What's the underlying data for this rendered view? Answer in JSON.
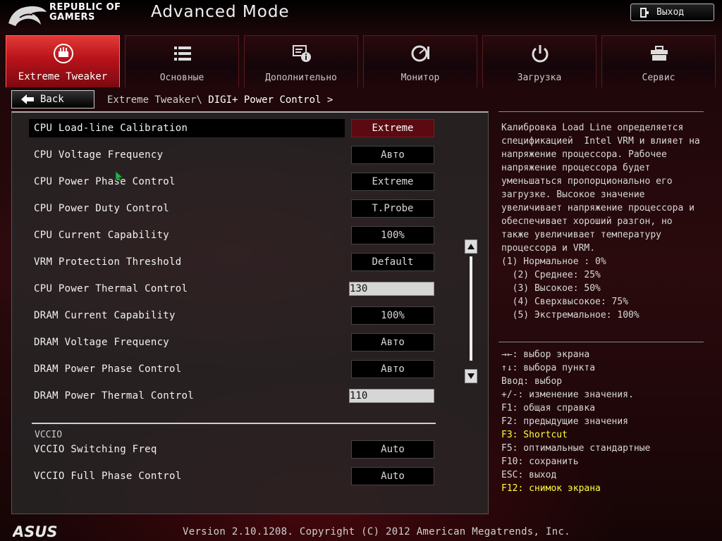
{
  "header": {
    "brand_line1": "REPUBLIC OF",
    "brand_line2": "GAMERS",
    "mode_title": "Advanced Mode",
    "exit_label": "Выход"
  },
  "tabs": [
    {
      "label": "Extreme Tweaker",
      "icon": "extreme-tweaker-icon",
      "active": true
    },
    {
      "label": "Основные",
      "icon": "main-list-icon",
      "active": false
    },
    {
      "label": "Дополнительно",
      "icon": "advanced-info-icon",
      "active": false
    },
    {
      "label": "Монитор",
      "icon": "monitor-gauge-icon",
      "active": false
    },
    {
      "label": "Загрузка",
      "icon": "power-icon",
      "active": false
    },
    {
      "label": "Сервис",
      "icon": "toolbox-icon",
      "active": false
    }
  ],
  "nav": {
    "back_label": "Back",
    "breadcrumb_path": "Extreme Tweaker\\",
    "breadcrumb_current": "DIGI+ Power Control >"
  },
  "settings": [
    {
      "label": "CPU Load-line Calibration",
      "value": "Extreme",
      "kind": "select",
      "selected": true
    },
    {
      "label": "CPU Voltage Frequency",
      "value": "Авто",
      "kind": "select"
    },
    {
      "label": "CPU Power Phase Control",
      "value": "Extreme",
      "kind": "select"
    },
    {
      "label": "CPU Power Duty Control",
      "value": "T.Probe",
      "kind": "select"
    },
    {
      "label": "CPU Current Capability",
      "value": "100%",
      "kind": "select"
    },
    {
      "label": "VRM Protection Threshold",
      "value": "Default",
      "kind": "select"
    },
    {
      "label": "CPU Power Thermal Control",
      "value": "130",
      "kind": "input"
    },
    {
      "label": "DRAM Current Capability",
      "value": "100%",
      "kind": "select"
    },
    {
      "label": "DRAM Voltage Frequency",
      "value": "Авто",
      "kind": "select"
    },
    {
      "label": "DRAM Power Phase Control",
      "value": "Авто",
      "kind": "select"
    },
    {
      "label": "DRAM Power Thermal Control",
      "value": "110",
      "kind": "input"
    }
  ],
  "section": {
    "title": "VCCIO",
    "settings": [
      {
        "label": "VCCIO Switching Freq",
        "value": "Auto",
        "kind": "select"
      },
      {
        "label": "VCCIO Full Phase Control",
        "value": "Auto",
        "kind": "select"
      }
    ]
  },
  "help": {
    "description": "Калибровка Load Line определяется\nспецификацией  Intel VRM и влияет на\nнапряжение процессора. Рабочее\nнапряжение процессора будет\nуменьшаться пропорционально его\nзагрузке. Высокое значение\nувеличивает напряжение процессора и\nобеспечивает хороший разгон, но\nтакже увеличивает температуру\nпроцессора и VRM.\n(1) Нормальное : 0%\n  (2) Среднее: 25%\n  (3) Высокое: 50%\n  (4) Сверхвысокое: 75%\n  (5) Экстремальное: 100%",
    "keys": [
      {
        "text": "→←: выбор экрана",
        "highlight": false
      },
      {
        "text": "↑↓: выбора пункта",
        "highlight": false
      },
      {
        "text": "Ввод: выбор",
        "highlight": false
      },
      {
        "text": "+/-: изменение значения.",
        "highlight": false
      },
      {
        "text": "F1: общая справка",
        "highlight": false
      },
      {
        "text": "F2: предыдущие значения",
        "highlight": false
      },
      {
        "text": "F3: Shortcut",
        "highlight": true
      },
      {
        "text": "F5: оптимальные стандартные",
        "highlight": false
      },
      {
        "text": "F10: сохранить",
        "highlight": false
      },
      {
        "text": "ESC: выход",
        "highlight": false
      },
      {
        "text": "F12: снимок экрана",
        "highlight": true
      }
    ]
  },
  "footer": {
    "brand": "ASUS",
    "version": "Version 2.10.1208. Copyright (C) 2012 American Megatrends, Inc."
  },
  "colors": {
    "accent_red": "#c8141c",
    "highlight_yellow": "#ffff40",
    "value_active": "#5a0a10"
  }
}
